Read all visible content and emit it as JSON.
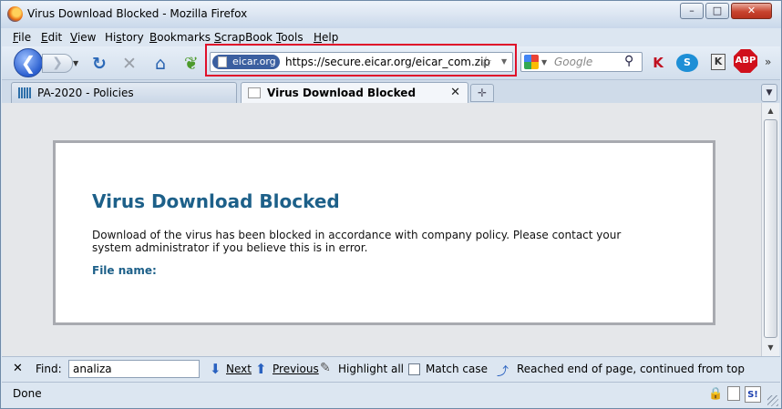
{
  "window": {
    "title": "Virus Download Blocked - Mozilla Firefox",
    "minimize_label": "–",
    "maximize_label": "□",
    "close_label": "✕"
  },
  "menubar": {
    "items": [
      {
        "key": "F",
        "rest": "ile"
      },
      {
        "key": "E",
        "rest": "dit"
      },
      {
        "key": "V",
        "rest": "iew"
      },
      {
        "key": "",
        "pre": "Hi",
        "keymid": "s",
        "rest": "tory"
      },
      {
        "key": "B",
        "rest": "ookmarks"
      },
      {
        "key": "S",
        "rest": "crapBook"
      },
      {
        "key": "T",
        "rest": "ools"
      },
      {
        "key": "H",
        "rest": "elp"
      }
    ]
  },
  "navbar": {
    "back_glyph": "❮",
    "forward_glyph": "❯",
    "reload_glyph": "↻",
    "stop_glyph": "✕",
    "home_glyph": "⌂",
    "leaf_glyph": "❦",
    "site_identity": "eicar.org",
    "url": "https://secure.eicar.org/eicar_com.zip",
    "search_placeholder": "Google",
    "abp_label": "ABP",
    "kaspersky_glyph": "K",
    "k_label": "K"
  },
  "tabs": [
    {
      "label": "PA-2020 - Policies",
      "active": false
    },
    {
      "label": "Virus Download Blocked",
      "active": true
    }
  ],
  "page": {
    "heading": "Virus Download Blocked",
    "message": "Download of the virus has been blocked in accordance with company policy. Please contact your system administrator if you believe this is in error.",
    "file_label": "File name:"
  },
  "findbar": {
    "label": "Find:",
    "value": "analiza",
    "next": "Next",
    "previous": "Previous",
    "highlight_all": "Highlight all",
    "match_case": "Match case",
    "status": "Reached end of page, continued from top"
  },
  "statusbar": {
    "text": "Done",
    "si_label": "S!"
  },
  "colors": {
    "heading": "#1d6089",
    "highlight_box": "#e0102a",
    "abp": "#d0101c"
  }
}
